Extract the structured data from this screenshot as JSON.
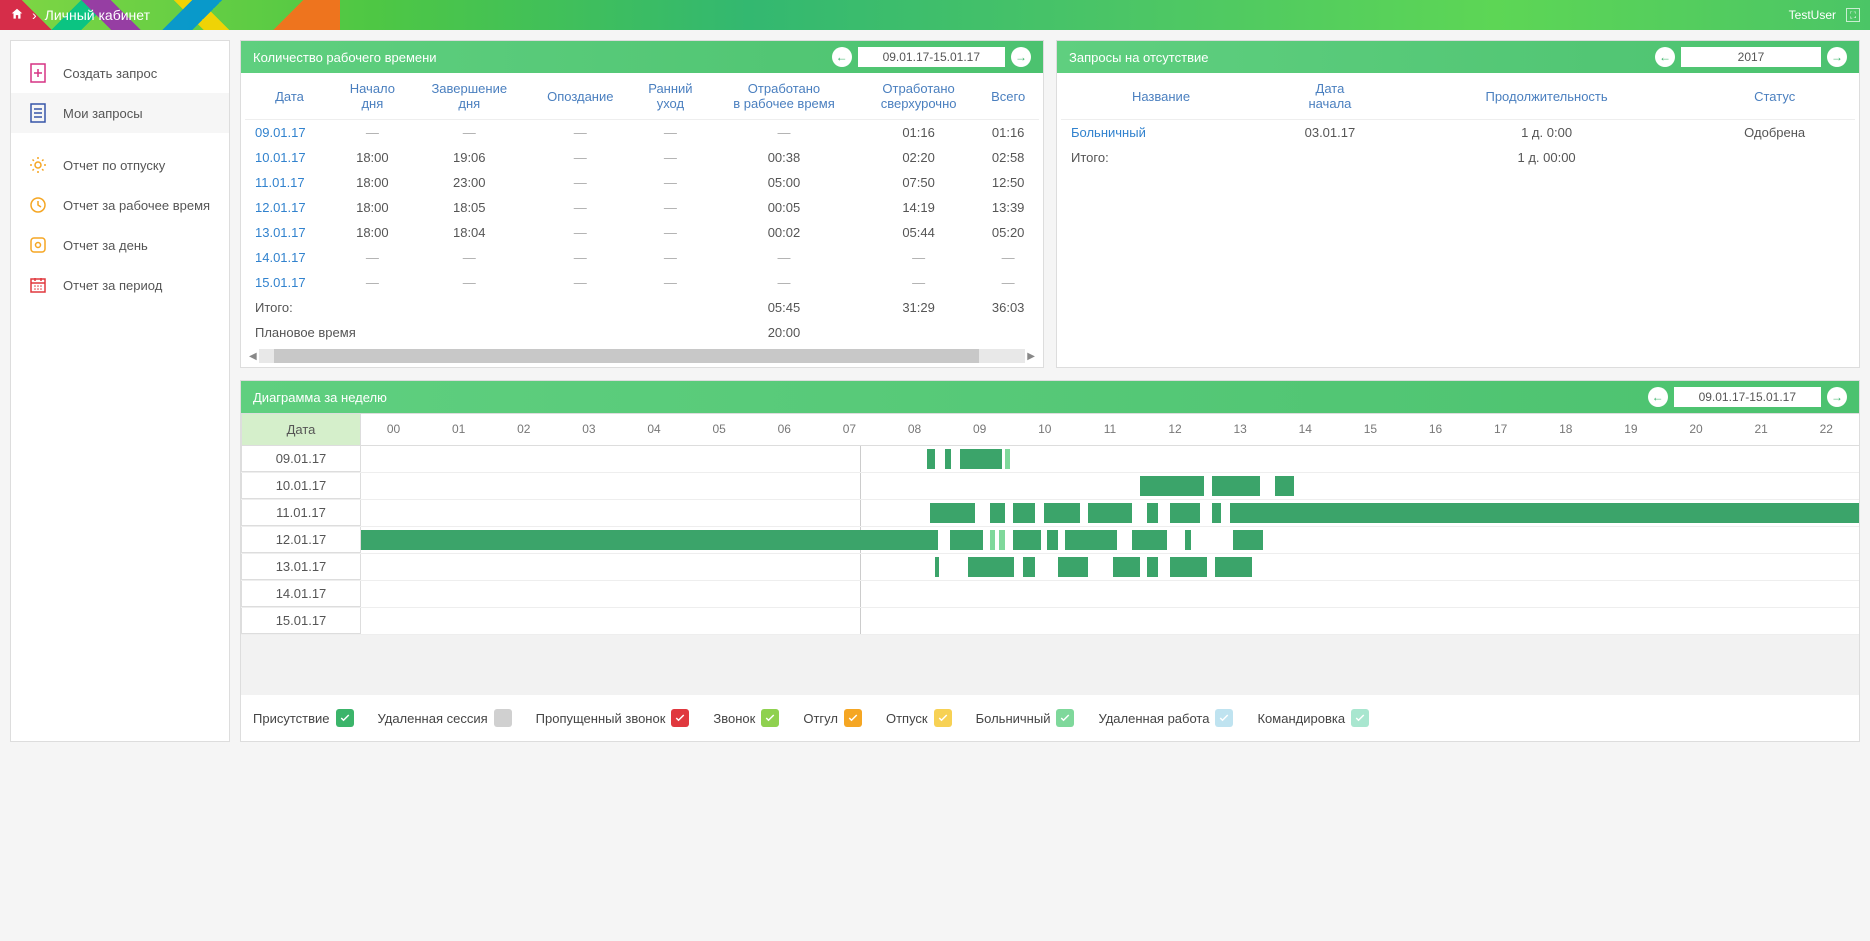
{
  "header": {
    "title": "Личный кабинет",
    "user": "TestUser"
  },
  "sidebar": {
    "items": [
      {
        "label": "Создать запрос"
      },
      {
        "label": "Мои запросы"
      },
      {
        "label": "Отчет по отпуску"
      },
      {
        "label": "Отчет за рабочее время"
      },
      {
        "label": "Отчет за день"
      },
      {
        "label": "Отчет за период"
      }
    ]
  },
  "worktime": {
    "title": "Количество рабочего времени",
    "range": "09.01.17-15.01.17",
    "columns": [
      "Дата",
      "Начало дня",
      "Завершение дня",
      "Опоздание",
      "Ранний уход",
      "Отработано в рабочее время",
      "Отработано сверхурочно",
      "Всего"
    ],
    "rows": [
      {
        "date": "09.01.17",
        "start": "—",
        "end": "—",
        "late": "—",
        "early": "—",
        "worked": "—",
        "over": "01:16",
        "total": "01:16"
      },
      {
        "date": "10.01.17",
        "start": "18:00",
        "end": "19:06",
        "late": "—",
        "early": "—",
        "worked": "00:38",
        "over": "02:20",
        "total": "02:58"
      },
      {
        "date": "11.01.17",
        "start": "18:00",
        "end": "23:00",
        "late": "—",
        "early": "—",
        "worked": "05:00",
        "over": "07:50",
        "total": "12:50"
      },
      {
        "date": "12.01.17",
        "start": "18:00",
        "end": "18:05",
        "late": "—",
        "early": "—",
        "worked": "00:05",
        "over": "14:19",
        "total": "13:39"
      },
      {
        "date": "13.01.17",
        "start": "18:00",
        "end": "18:04",
        "late": "—",
        "early": "—",
        "worked": "00:02",
        "over": "05:44",
        "total": "05:20"
      },
      {
        "date": "14.01.17",
        "start": "—",
        "end": "—",
        "late": "—",
        "early": "—",
        "worked": "—",
        "over": "—",
        "total": "—"
      },
      {
        "date": "15.01.17",
        "start": "—",
        "end": "—",
        "late": "—",
        "early": "—",
        "worked": "—",
        "over": "—",
        "total": "—"
      }
    ],
    "totals": {
      "label": "Итого:",
      "worked": "05:45",
      "over": "31:29",
      "total": "36:03"
    },
    "plan": {
      "label": "Плановое время",
      "worked": "20:00"
    }
  },
  "absences": {
    "title": "Запросы на отсутствие",
    "year": "2017",
    "columns": [
      "Название",
      "Дата начала",
      "Продолжительность",
      "Статус"
    ],
    "rows": [
      {
        "name": "Больничный",
        "start": "03.01.17",
        "duration": "1 д. 0:00",
        "status": "Одобрена"
      }
    ],
    "totals": {
      "label": "Итого:",
      "duration": "1 д. 00:00"
    }
  },
  "gantt": {
    "title": "Диаграмма за неделю",
    "range": "09.01.17-15.01.17",
    "date_col": "Дата",
    "hours": [
      "00",
      "01",
      "02",
      "03",
      "04",
      "05",
      "06",
      "07",
      "08",
      "09",
      "10",
      "11",
      "12",
      "13",
      "14",
      "15",
      "16",
      "17",
      "18",
      "19",
      "20",
      "21",
      "22"
    ],
    "rows": [
      {
        "date": "09.01.17",
        "bars": [
          {
            "s": 37.8,
            "e": 38.3
          },
          {
            "s": 39.0,
            "e": 39.4
          },
          {
            "s": 40.0,
            "e": 42.8
          },
          {
            "s": 43.0,
            "e": 43.3,
            "cls": "lt"
          }
        ]
      },
      {
        "date": "10.01.17",
        "bars": [
          {
            "s": 52.0,
            "e": 56.3
          },
          {
            "s": 56.8,
            "e": 60.0
          },
          {
            "s": 61.0,
            "e": 62.3
          }
        ]
      },
      {
        "date": "11.01.17",
        "bars": [
          {
            "s": 38.0,
            "e": 41.0
          },
          {
            "s": 42.0,
            "e": 43.0
          },
          {
            "s": 43.5,
            "e": 45.0
          },
          {
            "s": 45.6,
            "e": 48.0
          },
          {
            "s": 48.5,
            "e": 51.5
          },
          {
            "s": 52.5,
            "e": 53.2
          },
          {
            "s": 54.0,
            "e": 56.0
          },
          {
            "s": 56.8,
            "e": 57.4
          },
          {
            "s": 58.0,
            "e": 100
          }
        ]
      },
      {
        "date": "12.01.17",
        "bars": [
          {
            "s": 0,
            "e": 38.5
          },
          {
            "s": 39.3,
            "e": 41.5
          },
          {
            "s": 42.0,
            "e": 42.3,
            "cls": "lt"
          },
          {
            "s": 42.6,
            "e": 43.0,
            "cls": "lt"
          },
          {
            "s": 43.5,
            "e": 45.4
          },
          {
            "s": 45.8,
            "e": 46.5
          },
          {
            "s": 47.0,
            "e": 50.5
          },
          {
            "s": 51.5,
            "e": 53.8
          },
          {
            "s": 55.0,
            "e": 55.4
          },
          {
            "s": 58.2,
            "e": 60.2
          }
        ]
      },
      {
        "date": "13.01.17",
        "bars": [
          {
            "s": 38.3,
            "e": 38.6
          },
          {
            "s": 40.5,
            "e": 43.6
          },
          {
            "s": 44.2,
            "e": 45.0
          },
          {
            "s": 46.5,
            "e": 48.5
          },
          {
            "s": 50.2,
            "e": 52.0
          },
          {
            "s": 52.5,
            "e": 53.2
          },
          {
            "s": 54.0,
            "e": 56.5
          },
          {
            "s": 57.0,
            "e": 59.5
          }
        ]
      },
      {
        "date": "14.01.17",
        "bars": []
      },
      {
        "date": "15.01.17",
        "bars": []
      }
    ]
  },
  "legend": [
    {
      "label": "Присутствие",
      "color": "#3bb46a",
      "check": true
    },
    {
      "label": "Удаленная сессия",
      "color": "#d0d0d0",
      "check": false
    },
    {
      "label": "Пропущенный звонок",
      "color": "#e0383e",
      "check": true
    },
    {
      "label": "Звонок",
      "color": "#8fd14f",
      "check": true
    },
    {
      "label": "Отгул",
      "color": "#f5a623",
      "check": true
    },
    {
      "label": "Отпуск",
      "color": "#f7d154",
      "check": true
    },
    {
      "label": "Больничный",
      "color": "#7fd89b",
      "check": true
    },
    {
      "label": "Удаленная работа",
      "color": "#bfe3f0",
      "check": true
    },
    {
      "label": "Командировка",
      "color": "#a8e6cf",
      "check": true
    }
  ]
}
